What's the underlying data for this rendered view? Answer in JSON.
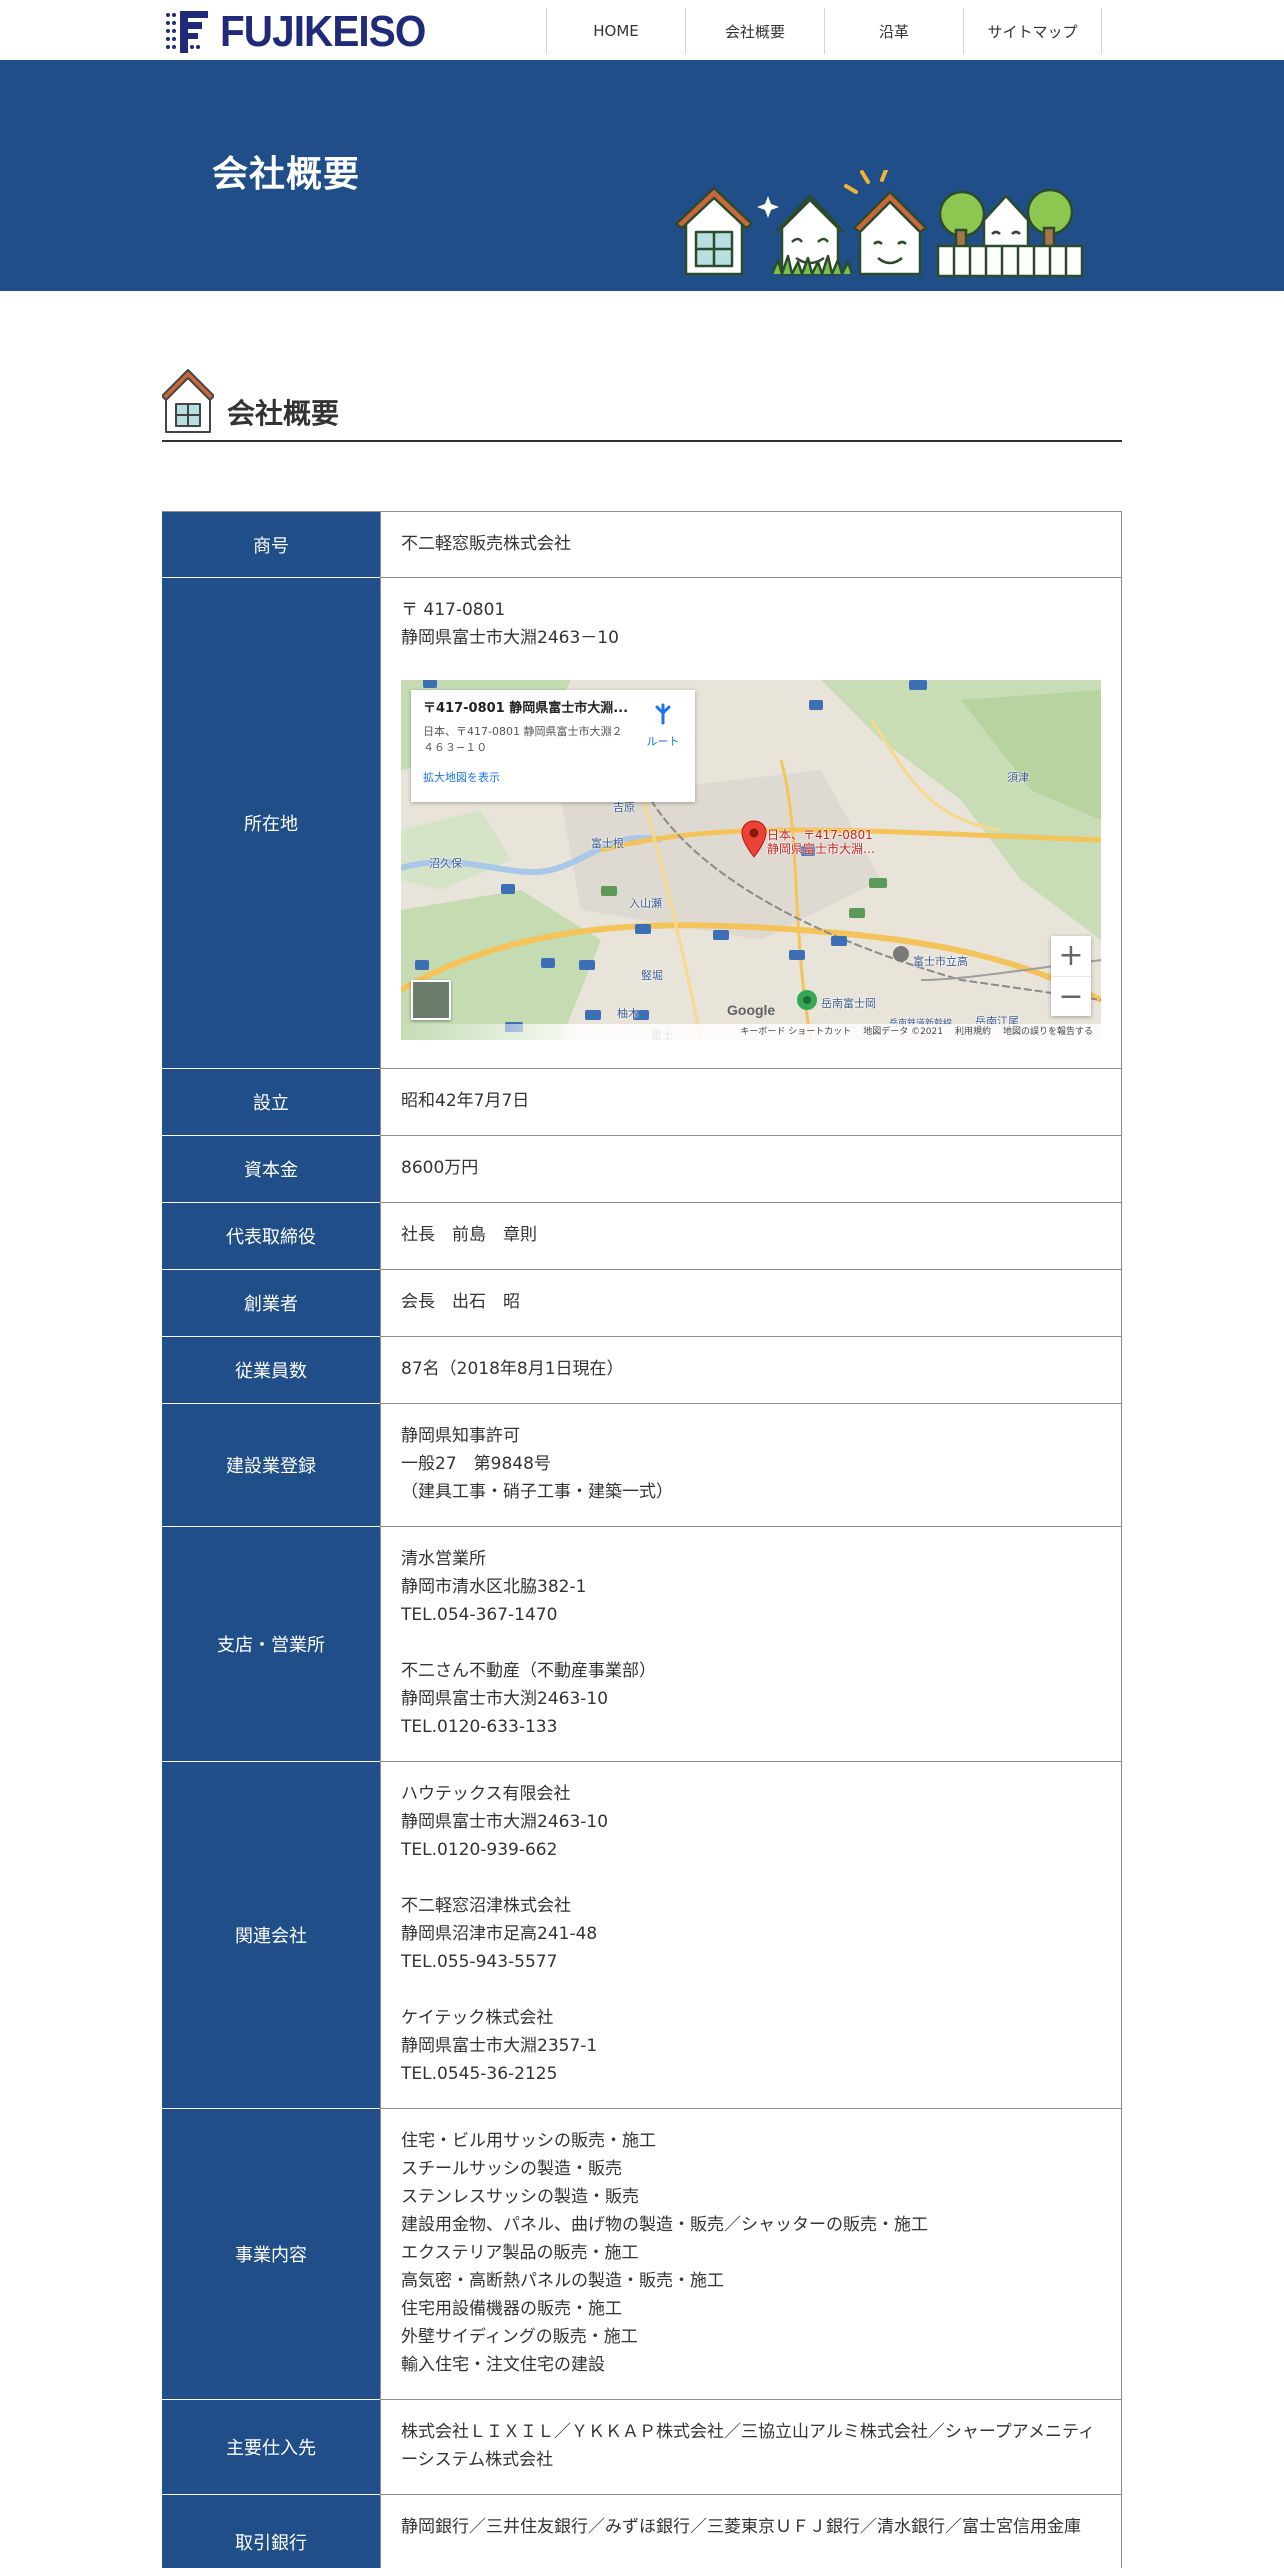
{
  "header": {
    "logo_text": "FUJIKEISO",
    "nav": [
      {
        "label": "HOME"
      },
      {
        "label": "会社概要"
      },
      {
        "label": "沿革"
      },
      {
        "label": "サイトマップ"
      }
    ]
  },
  "hero": {
    "title": "会社概要"
  },
  "section": {
    "title": "会社概要"
  },
  "map": {
    "card_title": "〒417-0801 静岡県富士市大淵...",
    "card_address": "日本、〒417-0801 静岡県富士市大淵２４６３−１０",
    "card_link": "拡大地図を表示",
    "route_label": "ルート",
    "pin_label_1": "日本、〒417-0801",
    "pin_label_2": "静岡県富士市大淵…",
    "footer_shortcuts": "キーボード ショートカット",
    "footer_data": "地図データ ©2021",
    "footer_terms": "利用規約",
    "footer_report": "地図の誤りを報告する",
    "google": "Google",
    "zoom_in": "+",
    "zoom_out": "−",
    "places": [
      "富士根",
      "沼久保",
      "入山瀬",
      "竪堀",
      "柚木",
      "富士",
      "富士市立高",
      "岳南富士岡",
      "岳南江尾",
      "吉原",
      "岳南鉄道新幹線",
      "須津"
    ]
  },
  "company": {
    "rows": [
      {
        "label": "商号",
        "lines": [
          "不二軽窓販売株式会社"
        ]
      },
      {
        "label": "所在地",
        "lines": [
          "〒 417-0801",
          "静岡県富士市大淵2463－10"
        ]
      },
      {
        "label": "設立",
        "lines": [
          "昭和42年7月7日"
        ]
      },
      {
        "label": "資本金",
        "lines": [
          "8600万円"
        ]
      },
      {
        "label": "代表取締役",
        "lines": [
          "社長　前島　章則"
        ]
      },
      {
        "label": "創業者",
        "lines": [
          "会長　出石　昭"
        ]
      },
      {
        "label": "従業員数",
        "lines": [
          "87名（2018年8月1日現在）"
        ]
      },
      {
        "label": "建設業登録",
        "lines": [
          "静岡県知事許可",
          "一般27　第9848号",
          "（建具工事・硝子工事・建築一式）"
        ]
      },
      {
        "label": "支店・営業所",
        "blocks": [
          [
            "清水営業所",
            "静岡市清水区北脇382-1",
            "TEL.054-367-1470"
          ],
          [
            "不二さん不動産（不動産事業部）",
            "静岡県富士市大渕2463-10",
            "TEL.0120-633-133"
          ]
        ]
      },
      {
        "label": "関連会社",
        "blocks": [
          [
            "ハウテックス有限会社",
            "静岡県富士市大淵2463-10",
            "TEL.0120-939-662"
          ],
          [
            "不二軽窓沼津株式会社",
            "静岡県沼津市足高241-48",
            "TEL.055-943-5577"
          ],
          [
            "ケイテック株式会社",
            "静岡県富士市大淵2357-1",
            "TEL.0545-36-2125"
          ]
        ]
      },
      {
        "label": "事業内容",
        "lines": [
          "住宅・ビル用サッシの販売・施工",
          "スチールサッシの製造・販売",
          "ステンレスサッシの製造・販売",
          "建設用金物、パネル、曲げ物の製造・販売／シャッターの販売・施工",
          "エクステリア製品の販売・施工",
          "高気密・高断熱パネルの製造・販売・施工",
          "住宅用設備機器の販売・施工",
          "外壁サイディングの販売・施工",
          "輸入住宅・注文住宅の建設"
        ]
      },
      {
        "label": "主要仕入先",
        "lines": [
          "株式会社ＬＩＸＩＬ／ＹＫＫＡＰ株式会社／三協立山アルミ株式会社／シャープアメニティーシステム株式会社"
        ]
      },
      {
        "label": "取引銀行",
        "lines": [
          "静岡銀行／三井住友銀行／みずほ銀行／三菱東京ＵＦＪ銀行／清水銀行／富士宮信用金庫"
        ]
      }
    ]
  },
  "colors": {
    "brand_blue": "#1f4e88",
    "logo_navy": "#1f2a7a",
    "text": "#333333"
  }
}
